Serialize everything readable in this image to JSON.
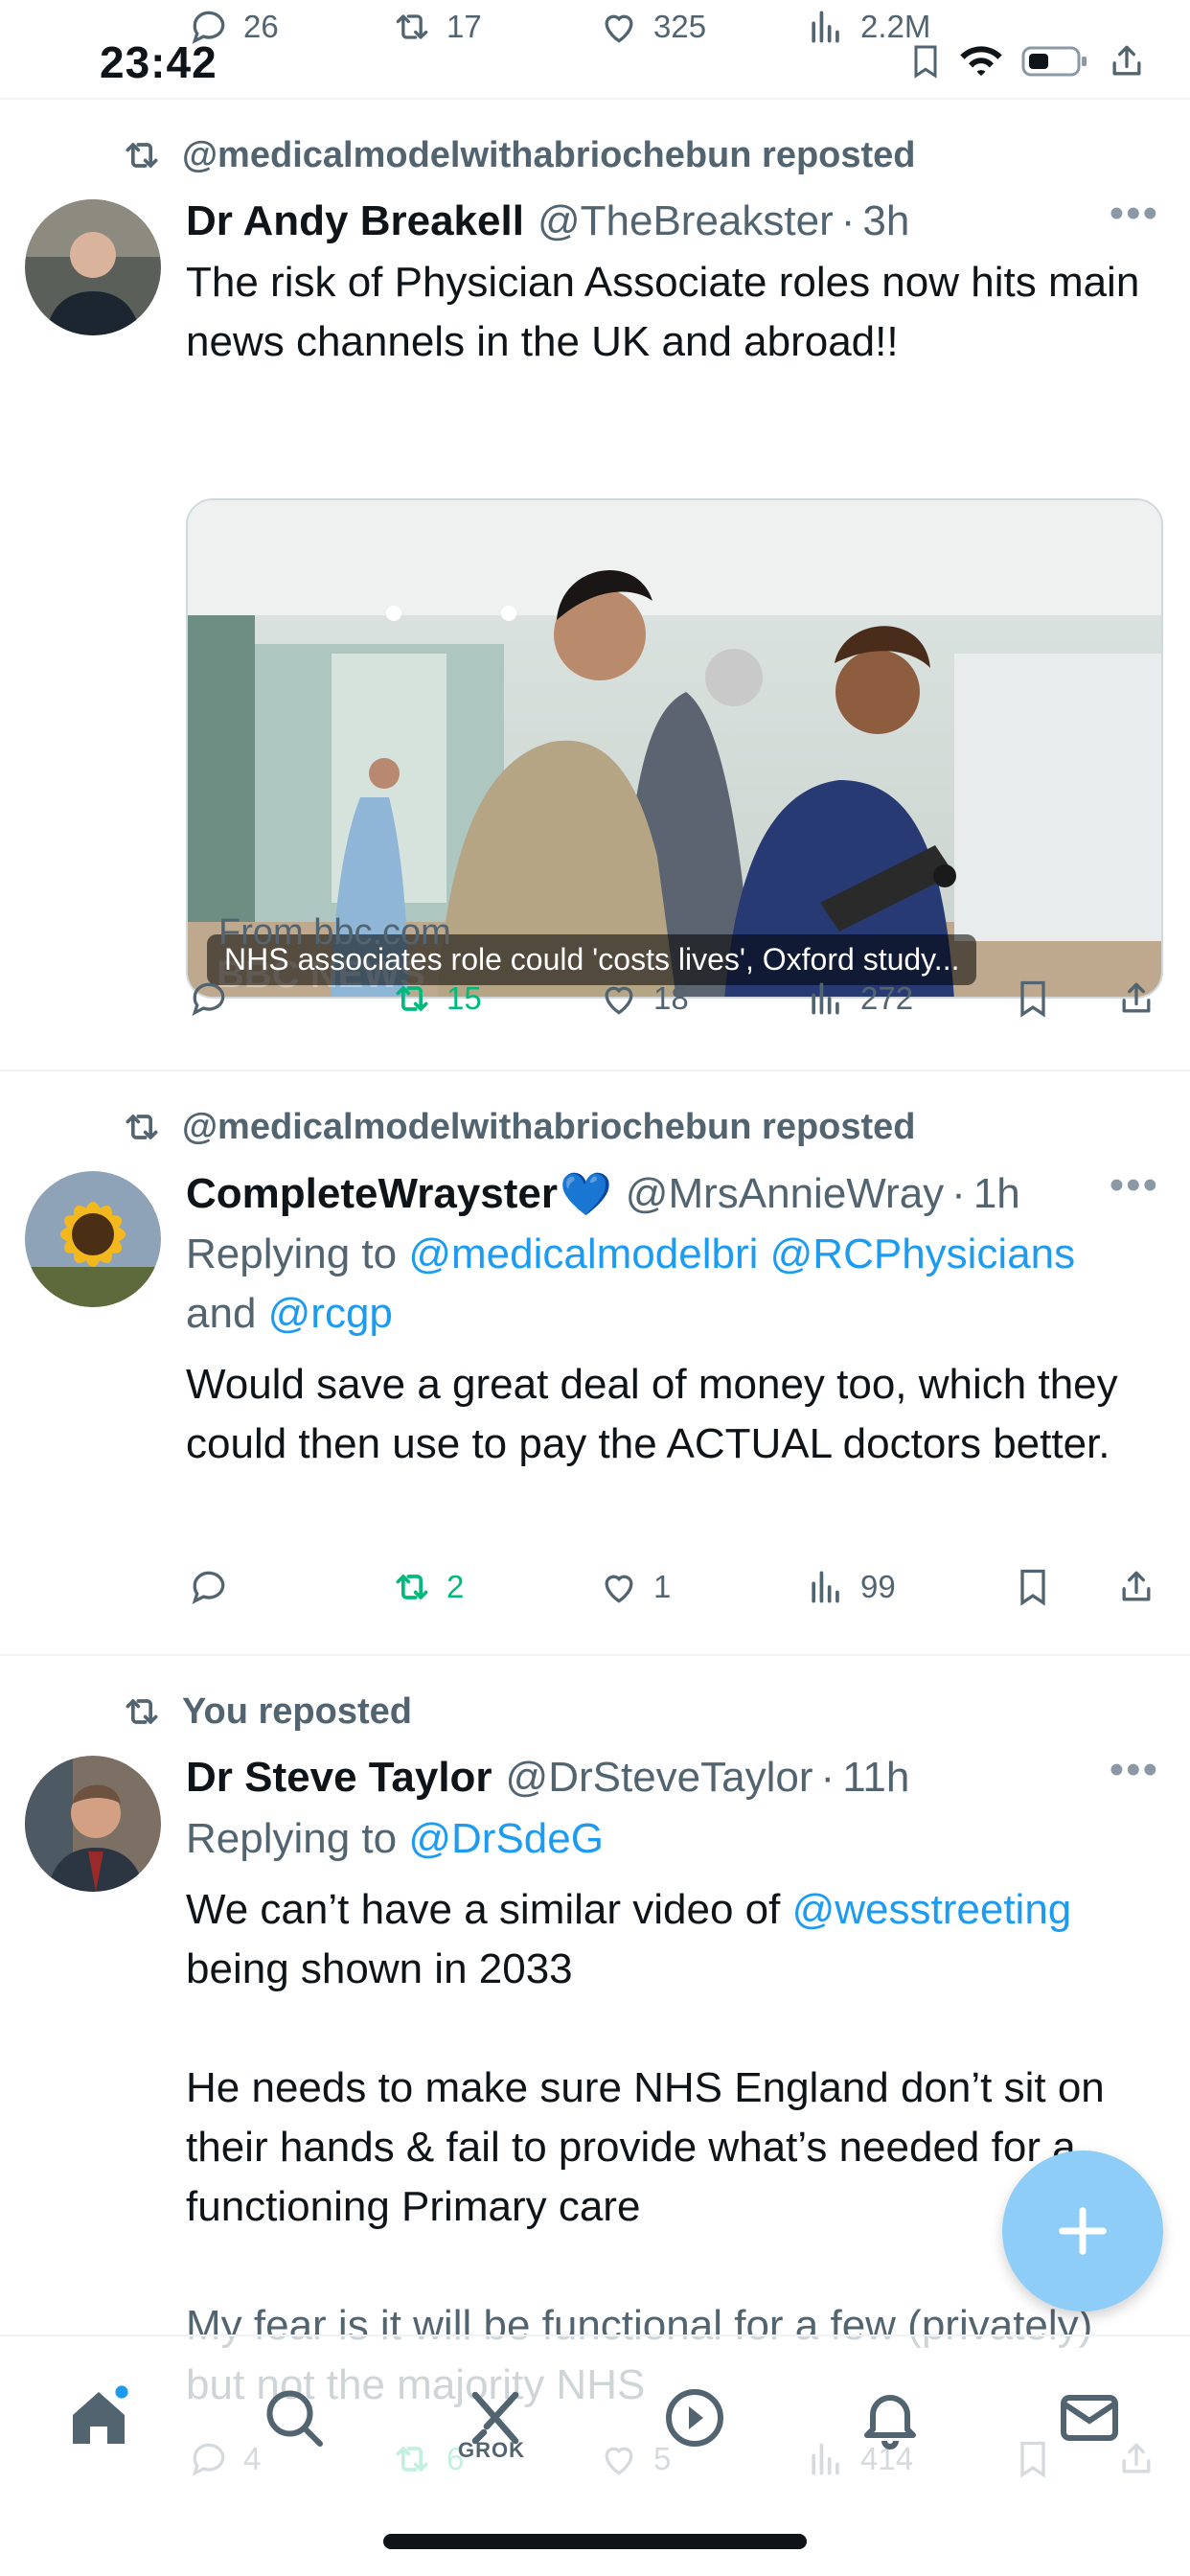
{
  "status_bar": {
    "time": "23:42"
  },
  "top_actions": {
    "replies": "26",
    "reposts": "17",
    "likes": "325",
    "views": "2.2M"
  },
  "tweets": [
    {
      "repost_label": "@medicalmodelwithabriochebun reposted",
      "name": "Dr Andy Breakell",
      "handle": "@TheBreakster",
      "time": "3h",
      "text": "The risk of Physician Associate roles now hits main news channels in the UK and abroad!!",
      "card_caption": "NHS associates role could 'costs lives', Oxford study...",
      "card_source": "From bbc.com",
      "watermark": "BBC NEWS",
      "stats": {
        "replies": "",
        "reposts": "15",
        "likes": "18",
        "views": "272"
      }
    },
    {
      "repost_label": "@medicalmodelwithabriochebun reposted",
      "name": "CompleteWrayster",
      "heart_emoji": "💙",
      "handle": "@MrsAnnieWray",
      "time": "1h",
      "reply_prefix": "Replying to ",
      "reply_to_1": "@medicalmodelbri",
      "reply_to_2": "@RCPhysicians",
      "reply_and": "and ",
      "reply_to_3": "@rcgp",
      "text": "Would save a great deal of money too, which they could then use to pay the ACTUAL doctors better.",
      "stats": {
        "replies": "",
        "reposts": "2",
        "likes": "1",
        "views": "99"
      }
    },
    {
      "repost_label": "You reposted",
      "name": "Dr Steve Taylor",
      "handle": "@DrSteveTaylor",
      "time": "11h",
      "reply_prefix": "Replying to ",
      "reply_to_1": "@DrSdeG",
      "text_1a": "We can’t have a similar video of ",
      "text_1_mention": "@wesstreeting",
      "text_1b": " being shown in 2033",
      "text_2": "He needs to make sure NHS England don’t sit on their hands & fail to provide what’s needed for a functioning Primary care",
      "text_3": "My fear is it will be functional for a few (privately) but not the majority NHS",
      "stats": {
        "replies": "4",
        "reposts": "6",
        "likes": "5",
        "views": "414"
      }
    }
  ],
  "nav": {
    "grok_label": "GROK"
  },
  "colors": {
    "accent": "#1d9bf0",
    "repost_green": "#00ba7c",
    "muted": "#536471",
    "fab": "#8ecdf7"
  }
}
